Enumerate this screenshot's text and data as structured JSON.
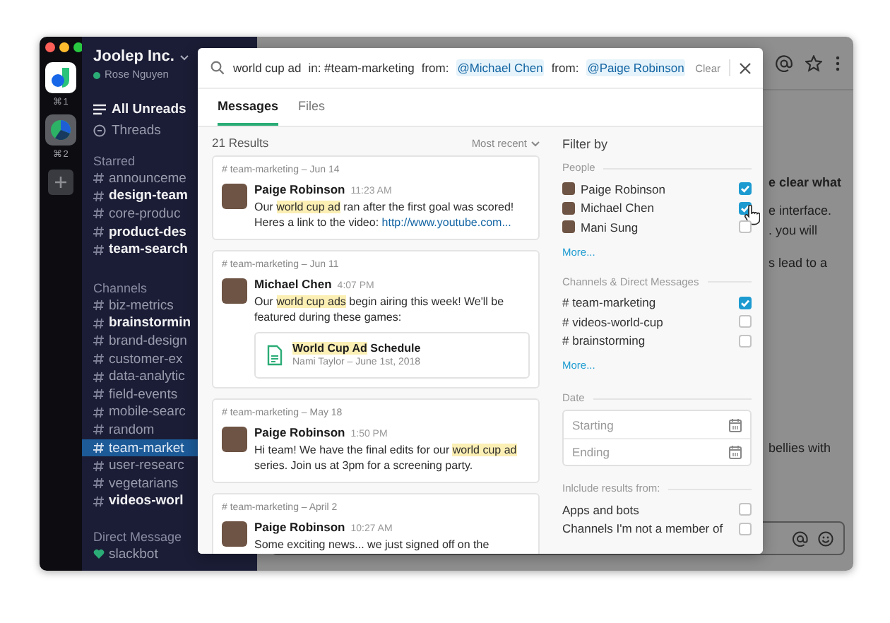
{
  "workspaces": [
    {
      "shortcut": "⌘1",
      "selected": true
    },
    {
      "shortcut": "⌘2",
      "selected": false
    }
  ],
  "sidebar": {
    "team": "Joolep Inc.",
    "user": "Rose Nguyen",
    "nav": [
      {
        "label": "All Unreads",
        "kind": "unreads"
      },
      {
        "label": "Threads",
        "kind": "threads"
      }
    ],
    "sections": [
      {
        "title": "Starred",
        "items": [
          {
            "label": "announceme",
            "kind": "channel",
            "unread": false,
            "selected": false
          },
          {
            "label": "design-team",
            "kind": "channel",
            "unread": true,
            "selected": false
          },
          {
            "label": "core-produc",
            "kind": "channel",
            "unread": false,
            "selected": false
          },
          {
            "label": "product-des",
            "kind": "channel",
            "unread": true,
            "selected": false
          },
          {
            "label": "team-search",
            "kind": "channel",
            "unread": true,
            "selected": false
          }
        ]
      },
      {
        "title": "Channels",
        "items": [
          {
            "label": "biz-metrics",
            "kind": "channel",
            "unread": false,
            "selected": false
          },
          {
            "label": "brainstormin",
            "kind": "channel",
            "unread": true,
            "selected": false
          },
          {
            "label": "brand-design",
            "kind": "channel",
            "unread": false,
            "selected": false
          },
          {
            "label": "customer-ex",
            "kind": "channel",
            "unread": false,
            "selected": false
          },
          {
            "label": "data-analytic",
            "kind": "channel",
            "unread": false,
            "selected": false
          },
          {
            "label": "field-events",
            "kind": "channel",
            "unread": false,
            "selected": false
          },
          {
            "label": "mobile-searc",
            "kind": "channel",
            "unread": false,
            "selected": false
          },
          {
            "label": "random",
            "kind": "channel",
            "unread": false,
            "selected": false
          },
          {
            "label": "team-market",
            "kind": "channel",
            "unread": false,
            "selected": true
          },
          {
            "label": "user-researc",
            "kind": "channel",
            "unread": false,
            "selected": false
          },
          {
            "label": "vegetarians",
            "kind": "channel",
            "unread": false,
            "selected": false
          },
          {
            "label": "videos-worl",
            "kind": "channel",
            "unread": true,
            "selected": false
          }
        ]
      },
      {
        "title": "Direct Message",
        "items": [
          {
            "label": "slackbot",
            "kind": "dm",
            "unread": false,
            "selected": false
          }
        ]
      }
    ]
  },
  "main": {
    "fragments": [
      {
        "text": "e clear what",
        "bold": true
      },
      {
        "text": "e interface.",
        "bold": false
      },
      {
        "text": ". you will",
        "bold": false
      },
      {
        "text": "s lead to a",
        "bold": false
      },
      {
        "text": "bellies with",
        "bold": false
      }
    ]
  },
  "search": {
    "query": [
      {
        "text": "world cup ad",
        "kind": "plain"
      },
      {
        "text": "in: #team-marketing",
        "kind": "plain"
      },
      {
        "text": "from:",
        "kind": "plain"
      },
      {
        "text": "@Michael Chen",
        "kind": "mention"
      },
      {
        "text": "from:",
        "kind": "plain"
      },
      {
        "text": "@Paige Robinson",
        "kind": "mention"
      }
    ],
    "clear": "Clear"
  },
  "tabs": [
    {
      "label": "Messages",
      "selected": true
    },
    {
      "label": "Files",
      "selected": false
    }
  ],
  "results": {
    "count": "21 Results",
    "sort": "Most recent",
    "items": [
      {
        "context": "# team-marketing – Jun 14",
        "author": "Paige Robinson",
        "time": "11:23 AM",
        "text": [
          {
            "text": "Our ",
            "kind": "plain"
          },
          {
            "text": "world cup ad",
            "kind": "highlight"
          },
          {
            "text": " ran after the first goal was scored! Heres a link to the video: ",
            "kind": "plain"
          },
          {
            "text": "http://www.youtube.com...",
            "kind": "link"
          }
        ]
      },
      {
        "context": "# team-marketing – Jun 11",
        "author": "Michael Chen",
        "time": "4:07 PM",
        "text": [
          {
            "text": "Our ",
            "kind": "plain"
          },
          {
            "text": "world cup ads",
            "kind": "highlight"
          },
          {
            "text": " begin airing this week! We'll be featured during these games:",
            "kind": "plain"
          }
        ],
        "attachment": {
          "title": [
            {
              "text": "World Cup Ad",
              "kind": "highlight"
            },
            {
              "text": " Schedule",
              "kind": "plain"
            }
          ],
          "meta": "Nami Taylor – June 1st, 2018"
        }
      },
      {
        "context": "# team-marketing – May 18",
        "author": "Paige Robinson",
        "time": "1:50 PM",
        "text": [
          {
            "text": "Hi team! We have the final edits for our ",
            "kind": "plain"
          },
          {
            "text": "world cup ad",
            "kind": "highlight"
          },
          {
            "text": " series. Join us at 3pm for a screening party.",
            "kind": "plain"
          }
        ]
      },
      {
        "context": "# team-marketing – April 2",
        "author": "Paige Robinson",
        "time": "10:27 AM",
        "text": [
          {
            "text": "Some exciting news... we just signed off on the",
            "kind": "plain"
          }
        ]
      }
    ]
  },
  "filters": {
    "title": "Filter by",
    "people": {
      "label": "People",
      "items": [
        {
          "name": "Paige Robinson",
          "checked": true
        },
        {
          "name": "Michael Chen",
          "checked": true
        },
        {
          "name": "Mani Sung",
          "checked": false
        }
      ],
      "more": "More..."
    },
    "channels": {
      "label": "Channels & Direct Messages",
      "items": [
        {
          "name": "# team-marketing",
          "checked": true
        },
        {
          "name": "# videos-world-cup",
          "checked": false
        },
        {
          "name": "# brainstorming",
          "checked": false
        }
      ],
      "more": "More..."
    },
    "date": {
      "label": "Date",
      "fields": [
        {
          "placeholder": "Starting"
        },
        {
          "placeholder": "Ending"
        }
      ]
    },
    "include": {
      "label": "Inlclude results from:",
      "items": [
        {
          "name": "Apps and bots",
          "checked": false
        },
        {
          "name": "Channels I'm not a member of",
          "checked": false
        }
      ]
    }
  }
}
